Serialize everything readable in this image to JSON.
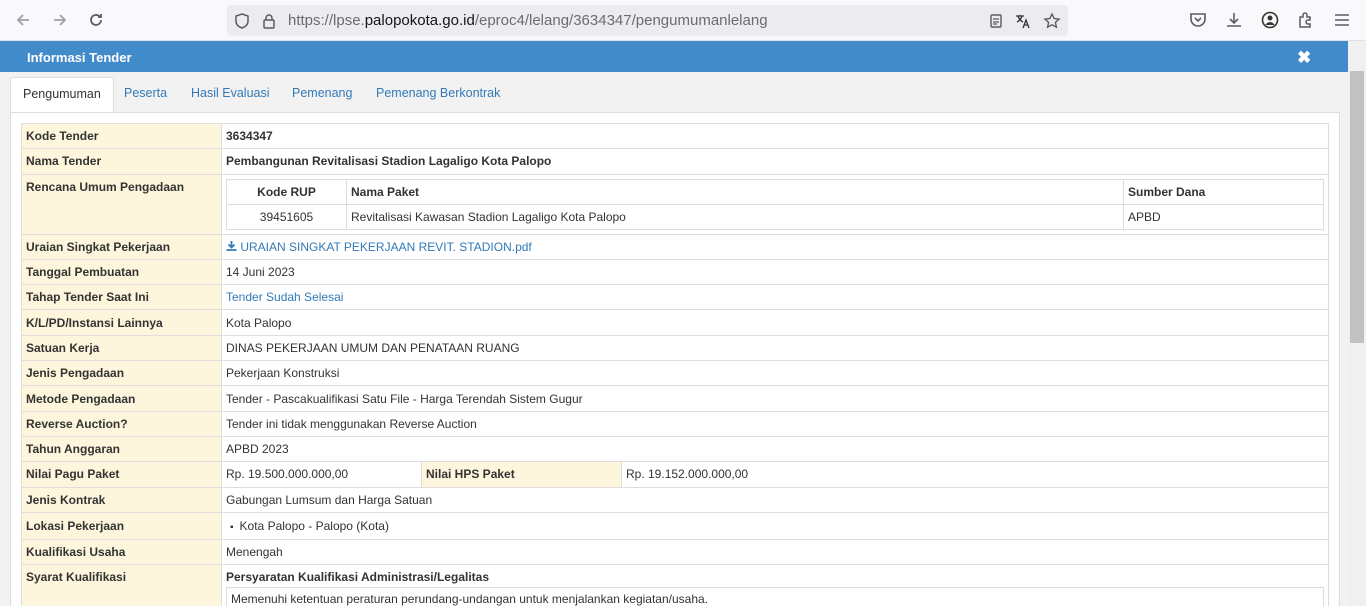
{
  "browser": {
    "url_prefix": "https://lpse.",
    "url_host": "palopokota.go.id",
    "url_path": "/eproc4/lelang/3634347/pengumumanlelang"
  },
  "modal": {
    "title": "Informasi Tender",
    "close_symbol": "✖"
  },
  "tabs": [
    "Pengumuman",
    "Peserta",
    "Hasil Evaluasi",
    "Pemenang",
    "Pemenang Berkontrak"
  ],
  "info": {
    "kode_tender_label": "Kode Tender",
    "kode_tender": "3634347",
    "nama_tender_label": "Nama Tender",
    "nama_tender": "Pembangunan Revitalisasi Stadion Lagaligo Kota Palopo",
    "rup_label": "Rencana Umum Pengadaan",
    "rup_headers": [
      "Kode RUP",
      "Nama Paket",
      "Sumber Dana"
    ],
    "rup_row": [
      "39451605",
      "Revitalisasi Kawasan Stadion Lagaligo Kota Palopo",
      "APBD"
    ],
    "uraian_label": "Uraian Singkat Pekerjaan",
    "uraian_link": "URAIAN SINGKAT PEKERJAAN REVIT. STADION.pdf",
    "tanggal_label": "Tanggal Pembuatan",
    "tanggal": "14 Juni 2023",
    "tahap_label": "Tahap Tender Saat Ini",
    "tahap": "Tender Sudah Selesai",
    "klpd_label": "K/L/PD/Instansi Lainnya",
    "klpd": "Kota Palopo",
    "satker_label": "Satuan Kerja",
    "satker": "DINAS PEKERJAAN UMUM DAN PENATAAN RUANG",
    "jenis_label": "Jenis Pengadaan",
    "jenis": "Pekerjaan Konstruksi",
    "metode_label": "Metode Pengadaan",
    "metode": "Tender - Pascakualifikasi Satu File - Harga Terendah Sistem Gugur",
    "reverse_label": "Reverse Auction?",
    "reverse": "Tender ini tidak menggunakan Reverse Auction",
    "tahun_label": "Tahun Anggaran",
    "tahun": "APBD 2023",
    "pagu_label": "Nilai Pagu Paket",
    "pagu": "Rp. 19.500.000.000,00",
    "hps_label": "Nilai HPS Paket",
    "hps": "Rp. 19.152.000.000,00",
    "kontrak_label": "Jenis Kontrak",
    "kontrak": "Gabungan Lumsum dan Harga Satuan",
    "lokasi_label": "Lokasi Pekerjaan",
    "lokasi": "Kota Palopo - Palopo (Kota)",
    "kualifikasi_label": "Kualifikasi Usaha",
    "kualifikasi": "Menengah",
    "syarat_label": "Syarat Kualifikasi",
    "syarat_heading": "Persyaratan Kualifikasi Administrasi/Legalitas",
    "syarat_item": "Memenuhi ketentuan peraturan perundang-undangan untuk menjalankan kegiatan/usaha."
  }
}
